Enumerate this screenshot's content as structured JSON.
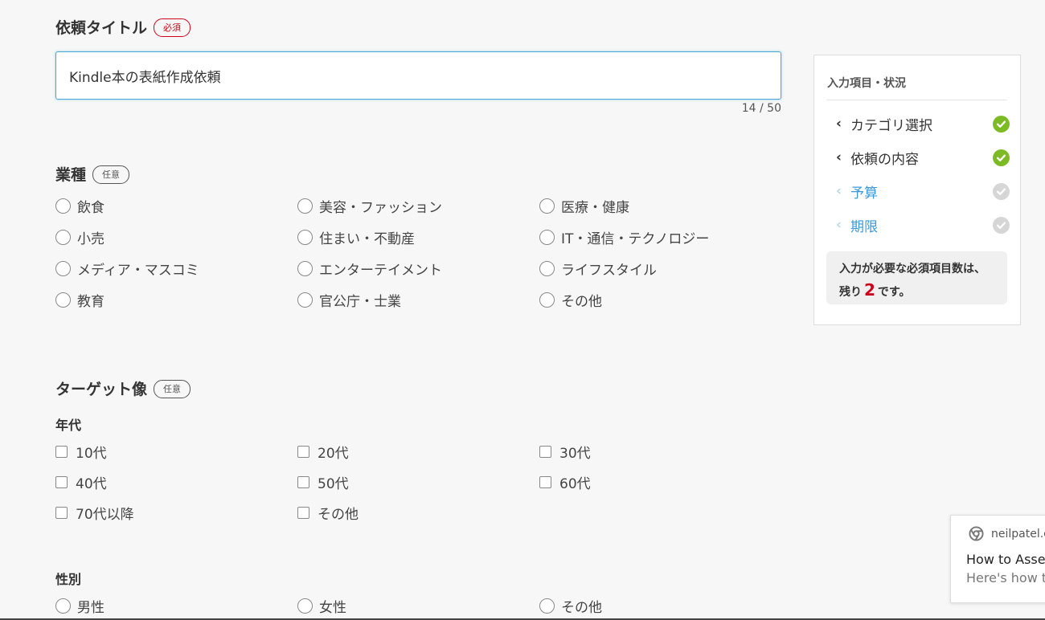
{
  "badges": {
    "required": "必須",
    "optional": "任意"
  },
  "title_section": {
    "label": "依頼タイトル",
    "input_value": "Kindle本の表紙作成依頼",
    "counter": "14 / 50"
  },
  "industry": {
    "label": "業種",
    "options": [
      "飲食",
      "美容・ファッション",
      "医療・健康",
      "小売",
      "住まい・不動産",
      "IT・通信・テクノロジー",
      "メディア・マスコミ",
      "エンターテイメント",
      "ライフスタイル",
      "教育",
      "官公庁・士業",
      "その他"
    ]
  },
  "target": {
    "label": "ターゲット像",
    "age": {
      "label": "年代",
      "options": [
        "10代",
        "20代",
        "30代",
        "40代",
        "50代",
        "60代",
        "70代以降",
        "その他"
      ]
    },
    "gender": {
      "label": "性別",
      "options": [
        "男性",
        "女性",
        "その他"
      ]
    }
  },
  "sidebar": {
    "title": "入力項目・状況",
    "items": [
      {
        "label": "カテゴリ選択",
        "status": "complete",
        "icon": "check-circle-icon"
      },
      {
        "label": "依頼の内容",
        "status": "complete",
        "icon": "check-circle-icon"
      },
      {
        "label": "予算",
        "status": "incomplete",
        "icon": "check-circle-icon"
      },
      {
        "label": "期限",
        "status": "incomplete",
        "icon": "check-circle-icon"
      }
    ],
    "note_line1": "入力が必要な必須項目数は、",
    "note_prefix": "残り",
    "note_count": "2",
    "note_suffix": "です。"
  },
  "toast": {
    "site": "neilpatel.c",
    "title": "How to Asse",
    "body": "Here's how t",
    "icon": "chrome-icon"
  },
  "colors": {
    "accent": "#3a9ad9",
    "required": "#d0021b",
    "complete": "#7cbb23",
    "pending": "#d6d6d6"
  }
}
